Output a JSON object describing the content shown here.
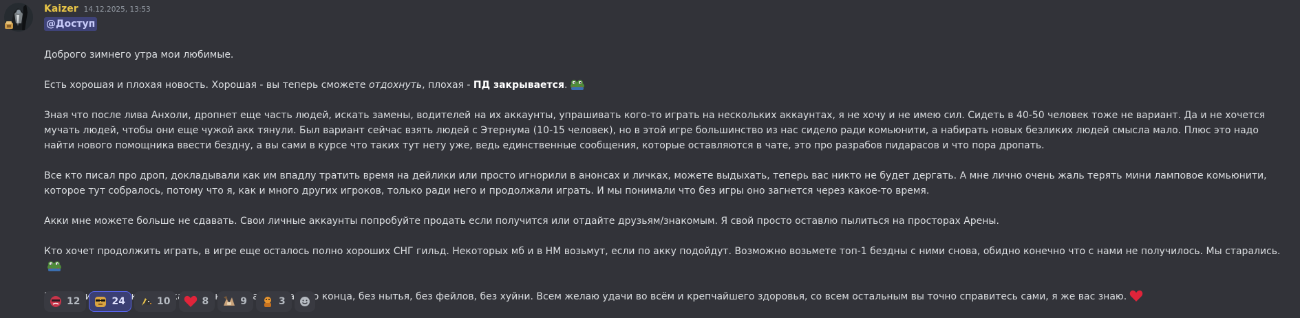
{
  "message": {
    "author": "Kaizer",
    "timestamp": "14.12.2025, 13:53",
    "mention": "@Доступ",
    "colors": {
      "author": "#e8c547",
      "mention_bg": "#3f4379",
      "background": "#323339"
    },
    "paragraphs": {
      "p1": "Доброго зимнего утра мои любимые.",
      "p2_a": "Есть хорошая и плохая новость. Хорошая - вы теперь сможете ",
      "p2_b": "отдохнуть",
      "p2_c": ", плохая - ",
      "p2_d": "ПД закрывается",
      "p2_e": ".",
      "p3": "Зная что после лива Анхоли, дропнет еще часть людей, искать замены, водителей на их аккаунты, упрашивать кого-то играть на нескольких аккаунтах, я не хочу и не имею сил. Сидеть в 40-50 человек тоже не вариант. Да и не хочется мучать людей, чтобы они еще чужой акк тянули. Был вариант сейчас взять людей с Этернума (10-15 человек), но в этой игре большинство из нас сидело ради комьюнити, а набирать новых безликих людей смысла мало. Плюс это надо найти нового помощника ввести бездну, а вы сами в курсе что таких тут нету уже, ведь единственные сообщения, которые оставляются в чате, это про разрабов пидарасов и что пора дропать.",
      "p4": "Все кто писал про дроп, докладывали как им впадлу тратить время на дейлики или просто игнорили в анонсах и личках, можете выдыхать, теперь вас никто не будет дергать. А мне лично очень жаль терять мини ламповое комьюнити, которое тут собралось, потому что я, как и много других игроков, только ради него и продолжали играть. И мы понимали что без игры оно загнется через какое-то время.",
      "p5": "Акки мне можете больше не сдавать. Свои личные аккаунты попробуйте продать если получится или отдайте друзьям/знакомым. Я свой просто оставлю пылиться на просторах Арены.",
      "p6": "Кто хочет продолжить играть, в игре еще осталось полно хороших СНГ гильд. Некоторых мб и в НМ возьмут, если по акку подойдут. Возможно возьмете топ-1 бездны с ними снова, обидно конечно что с нами не получилось. Мы старались.",
      "p7": "Безгранично ценю и уважаю тех кто играл до самого конца, без нытья, без фейлов, без хуйни. Всем желаю удачи во всём и крепчайшего здоровья, со всем остальным вы точно справитесь сами, я же вас знаю."
    },
    "inline_emojis": [
      "frog-emoji",
      "frog-emoji",
      "red-heart-emoji"
    ]
  },
  "reactions": [
    {
      "icon": "red-face-emoji",
      "count": "12",
      "active": false
    },
    {
      "icon": "doge-sunglasses-emoji",
      "count": "24",
      "active": true
    },
    {
      "icon": "party-bird-emoji",
      "count": "10",
      "active": false
    },
    {
      "icon": "red-heart-emoji",
      "count": "8",
      "active": false
    },
    {
      "icon": "handshake-cats-emoji",
      "count": "9",
      "active": false
    },
    {
      "icon": "orange-character-emoji",
      "count": "3",
      "active": false
    }
  ],
  "add_reaction_icon": "add-reaction-icon"
}
